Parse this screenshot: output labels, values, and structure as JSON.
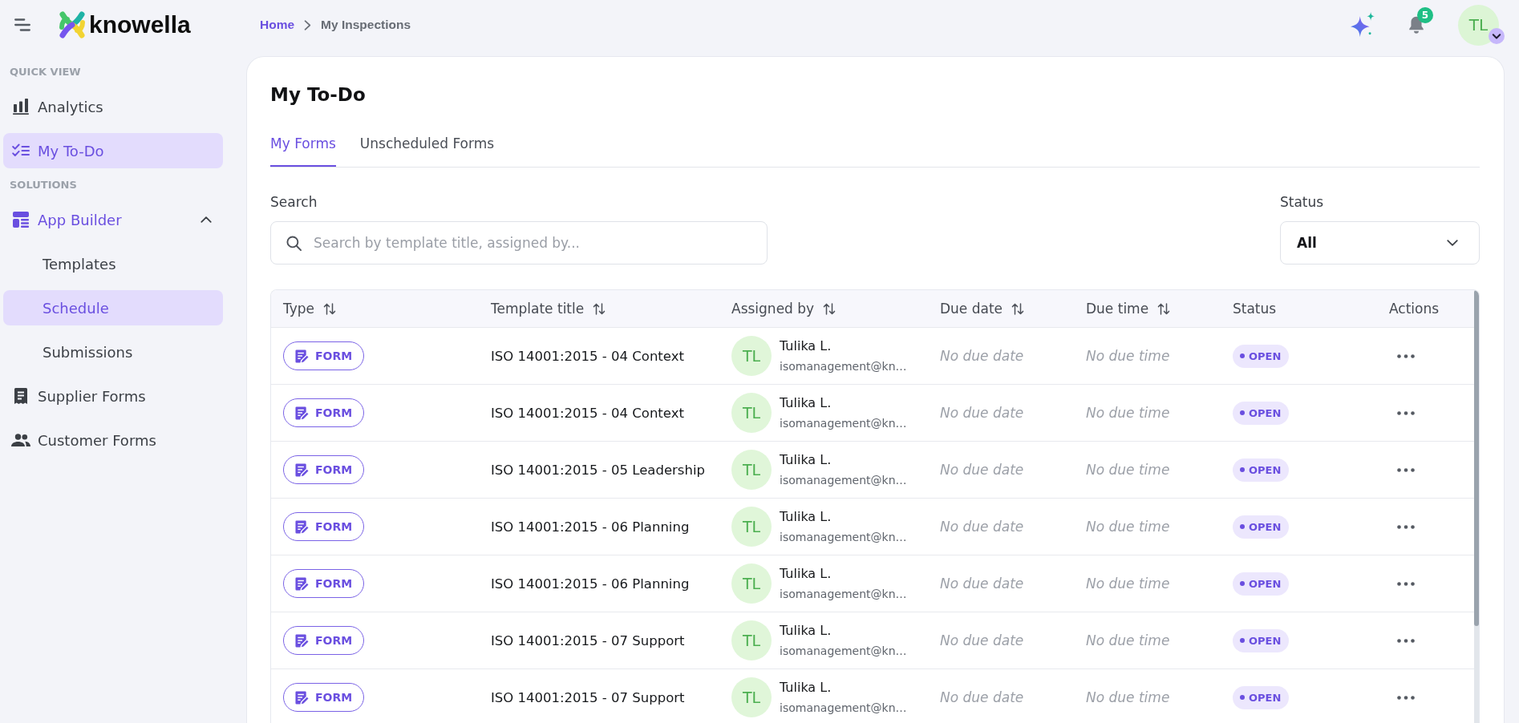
{
  "topbar": {
    "logo": "knowella",
    "breadcrumb": [
      {
        "label": "Home",
        "current": false
      },
      {
        "label": "My Inspections",
        "current": true
      }
    ],
    "notifications": {
      "count": "5"
    },
    "user": {
      "initials": "TL"
    }
  },
  "sidebar": {
    "sections": [
      {
        "heading": "QUICK VIEW",
        "items": [
          {
            "label": "Analytics",
            "selected": false
          },
          {
            "label": "My To-Do",
            "selected": true
          }
        ]
      },
      {
        "heading": "SOLUTIONS",
        "items": [
          {
            "label": "App Builder",
            "selected": false,
            "expanded": true,
            "children": [
              {
                "label": "Templates",
                "selected": false
              },
              {
                "label": "Schedule",
                "selected": true
              },
              {
                "label": "Submissions",
                "selected": false
              }
            ]
          },
          {
            "label": "Supplier Forms",
            "selected": false
          },
          {
            "label": "Customer Forms",
            "selected": false
          }
        ]
      }
    ]
  },
  "page": {
    "title": "My To-Do",
    "tabs": [
      {
        "label": "My Forms",
        "selected": true
      },
      {
        "label": "Unscheduled Forms",
        "selected": false
      }
    ],
    "search": {
      "label": "Search",
      "placeholder": "Search by template title, assigned by..."
    },
    "status_filter": {
      "label": "Status",
      "value": "All"
    },
    "table": {
      "columns": [
        {
          "label": "Type",
          "sortable": true
        },
        {
          "label": "Template title",
          "sortable": true
        },
        {
          "label": "Assigned by",
          "sortable": true
        },
        {
          "label": "Due date",
          "sortable": true
        },
        {
          "label": "Due time",
          "sortable": true
        },
        {
          "label": "Status",
          "sortable": false
        },
        {
          "label": "Actions",
          "sortable": false
        }
      ],
      "rows": [
        {
          "type": "FORM",
          "title": "ISO 14001:2015 - 04 Context",
          "assigned_by": {
            "initials": "TL",
            "name": "Tulika L.",
            "email": "isomanagement@kn…"
          },
          "due_date": "No due date",
          "due_time": "No due time",
          "status": "OPEN"
        },
        {
          "type": "FORM",
          "title": "ISO 14001:2015 - 04 Context",
          "assigned_by": {
            "initials": "TL",
            "name": "Tulika L.",
            "email": "isomanagement@kn…"
          },
          "due_date": "No due date",
          "due_time": "No due time",
          "status": "OPEN"
        },
        {
          "type": "FORM",
          "title": "ISO 14001:2015 - 05 Leadership",
          "assigned_by": {
            "initials": "TL",
            "name": "Tulika L.",
            "email": "isomanagement@kn…"
          },
          "due_date": "No due date",
          "due_time": "No due time",
          "status": "OPEN"
        },
        {
          "type": "FORM",
          "title": "ISO 14001:2015 - 06 Planning",
          "assigned_by": {
            "initials": "TL",
            "name": "Tulika L.",
            "email": "isomanagement@kn…"
          },
          "due_date": "No due date",
          "due_time": "No due time",
          "status": "OPEN"
        },
        {
          "type": "FORM",
          "title": "ISO 14001:2015 - 06 Planning",
          "assigned_by": {
            "initials": "TL",
            "name": "Tulika L.",
            "email": "isomanagement@kn…"
          },
          "due_date": "No due date",
          "due_time": "No due time",
          "status": "OPEN"
        },
        {
          "type": "FORM",
          "title": "ISO 14001:2015 - 07 Support",
          "assigned_by": {
            "initials": "TL",
            "name": "Tulika L.",
            "email": "isomanagement@kn…"
          },
          "due_date": "No due date",
          "due_time": "No due time",
          "status": "OPEN"
        },
        {
          "type": "FORM",
          "title": "ISO 14001:2015 - 07 Support",
          "assigned_by": {
            "initials": "TL",
            "name": "Tulika L.",
            "email": "isomanagement@kn…"
          },
          "due_date": "No due date",
          "due_time": "No due time",
          "status": "OPEN"
        }
      ]
    }
  }
}
